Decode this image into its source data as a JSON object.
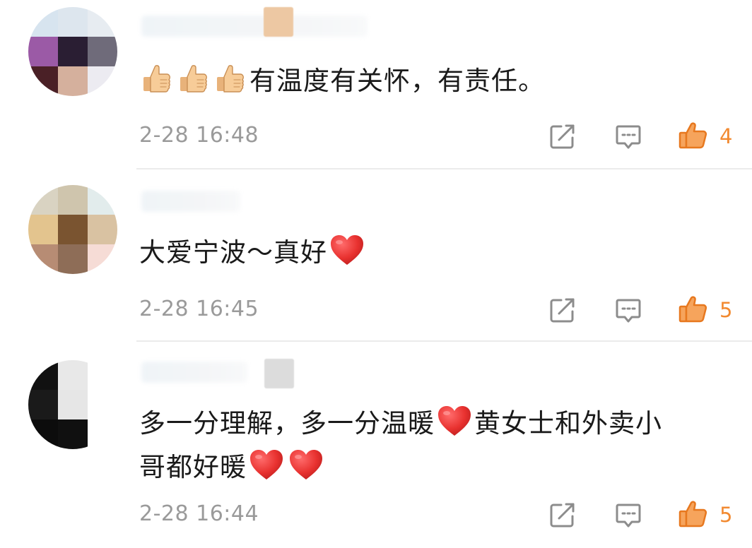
{
  "colors": {
    "accent_orange": "#F28A31",
    "timestamp_gray": "#9A9A9A",
    "icon_gray": "#8C8C8C",
    "heart_red": "#E8312F",
    "divider": "#EBEBEB"
  },
  "comments": [
    {
      "text": "有温度有关怀，有责任。",
      "prefix_emoji": [
        "thumbs-up",
        "thumbs-up",
        "thumbs-up"
      ],
      "timestamp": "2-28 16:48",
      "likes": "4",
      "icons": {
        "share": "share-icon",
        "reply": "reply-icon",
        "like": "like-icon"
      }
    },
    {
      "text": "大爱宁波～真好",
      "suffix_emoji": [
        "heart"
      ],
      "timestamp": "2-28 16:45",
      "likes": "5",
      "icons": {
        "share": "share-icon",
        "reply": "reply-icon",
        "like": "like-icon"
      }
    },
    {
      "text_part1": "多一分理解，多一分温暖",
      "text_part2": "黄女士和外卖小",
      "text_line2": "哥都好暖",
      "emoji": [
        "heart",
        "heart",
        "heart"
      ],
      "timestamp": "2-28 16:44",
      "likes": "5",
      "icons": {
        "share": "share-icon",
        "reply": "reply-icon",
        "like": "like-icon"
      }
    }
  ]
}
